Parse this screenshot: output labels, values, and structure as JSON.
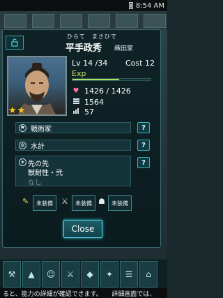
{
  "status": {
    "time": "8:54 AM"
  },
  "general": {
    "ruby": "ひらて　まさひで",
    "name": "平手政秀",
    "clan": "織田家",
    "stars": 2,
    "level": "Lv 14 /34",
    "cost": "Cost 12",
    "exp_label": "Exp",
    "exp_progress": 0.6,
    "hp": "1426 / 1426",
    "attack": "1564",
    "defense": "57"
  },
  "skills": [
    {
      "name": "戦術家",
      "icon": "flag-icon"
    },
    {
      "name": "水計",
      "icon": "water-icon"
    }
  ],
  "tactic": {
    "title": "先の先",
    "sub": "獣耐性・弐",
    "none": "なし"
  },
  "equipment": [
    {
      "label": "未装備"
    },
    {
      "label": "未装備"
    },
    {
      "label": "未装備"
    }
  ],
  "close_label": "Close",
  "help_label": "?",
  "footer_text": "ると、能力の詳細が確認できます。　　詳細画面では、"
}
